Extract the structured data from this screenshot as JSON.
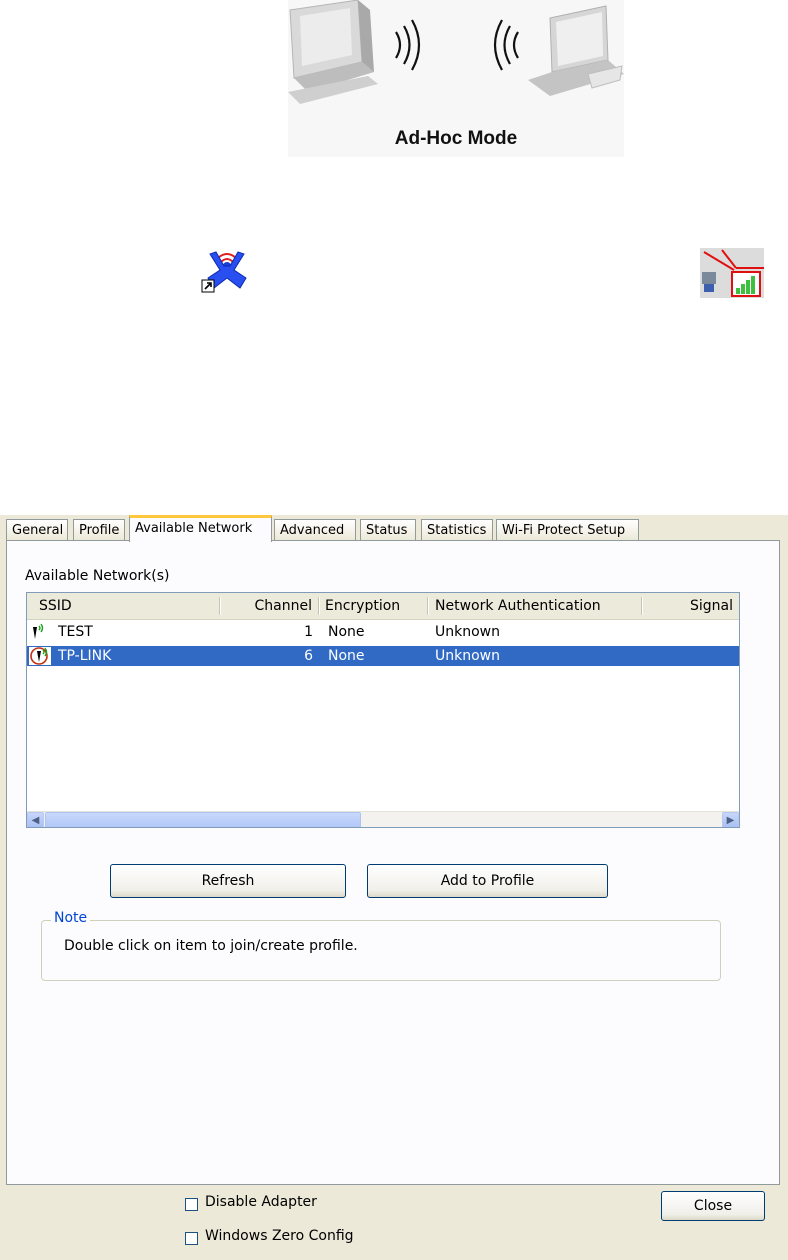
{
  "illustration": {
    "caption": "Ad-Hoc Mode"
  },
  "tabs": [
    "General",
    "Profile",
    "Available Network",
    "Advanced",
    "Status",
    "Statistics",
    "Wi-Fi Protect Setup"
  ],
  "active_tab": "Available Network",
  "available_label": "Available Network(s)",
  "list": {
    "columns": [
      "SSID",
      "Channel",
      "Encryption",
      "Network Authentication",
      "Signal"
    ],
    "rows": [
      {
        "ssid": "TEST",
        "channel": "1",
        "encryption": "None",
        "auth": "Unknown",
        "icon": "wireless-ap-icon",
        "selected": false
      },
      {
        "ssid": "TP-LINK",
        "channel": "6",
        "encryption": "None",
        "auth": "Unknown",
        "icon": "adhoc-network-icon",
        "selected": true
      }
    ]
  },
  "buttons": {
    "refresh": "Refresh",
    "add_to_profile": "Add to Profile",
    "close": "Close"
  },
  "note": {
    "legend": "Note",
    "text": "Double click on item to join/create profile."
  },
  "options": {
    "disable_adapter": "Disable Adapter",
    "windows_zero_config": "Windows Zero Config"
  },
  "colors": {
    "selection": "#316ac5",
    "dialog_bg": "#ece9d8",
    "active_tab_accent": "#ffc83c",
    "note_legend": "#0046d5"
  }
}
